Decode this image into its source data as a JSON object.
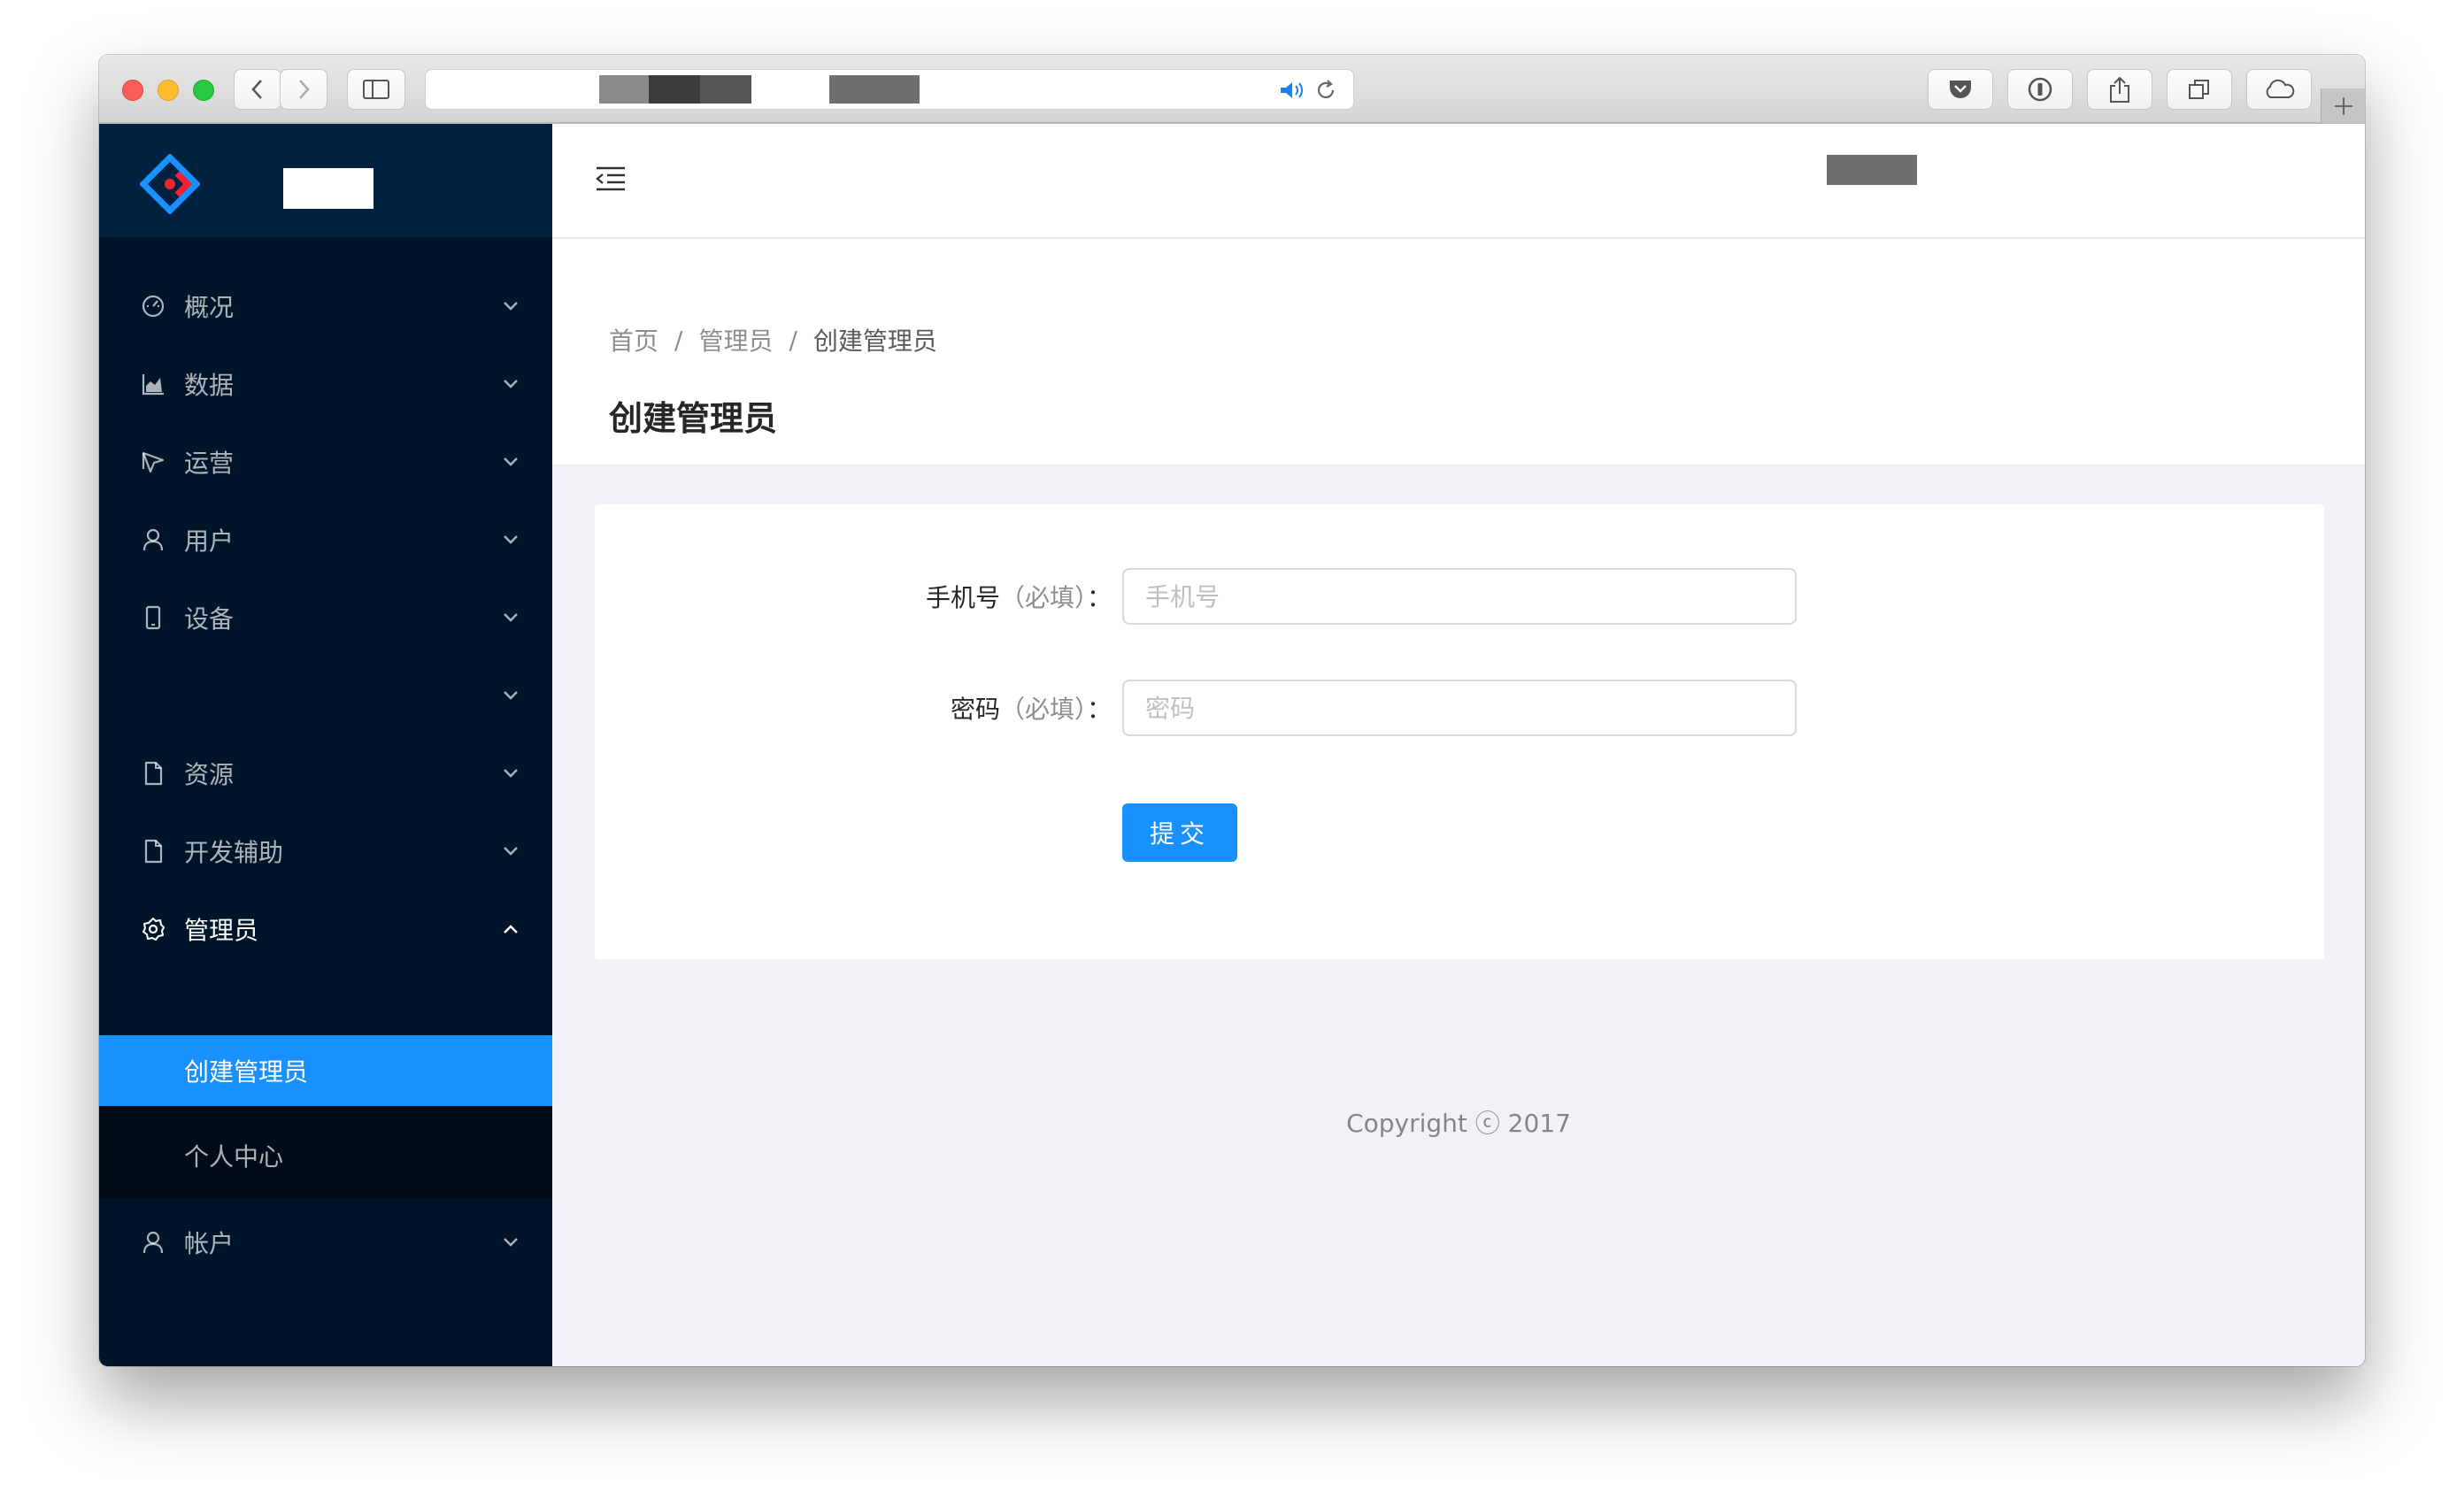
{
  "sidebar": {
    "items": [
      {
        "label": "概况",
        "icon": "dashboard-icon"
      },
      {
        "label": "数据",
        "icon": "area-chart-icon"
      },
      {
        "label": "运营",
        "icon": "cursor-icon"
      },
      {
        "label": "用户",
        "icon": "user-icon"
      },
      {
        "label": "设备",
        "icon": "mobile-icon"
      },
      {
        "label": "",
        "icon": ""
      },
      {
        "label": "资源",
        "icon": "file-icon"
      },
      {
        "label": "开发辅助",
        "icon": "file-icon"
      },
      {
        "label": "管理员",
        "icon": "setting-icon"
      },
      {
        "label": "帐户",
        "icon": "user-icon"
      }
    ],
    "submenu": [
      {
        "label": "创建管理员"
      },
      {
        "label": "个人中心"
      }
    ]
  },
  "breadcrumb": {
    "home": "首页",
    "section": "管理员",
    "current": "创建管理员",
    "separator": "/"
  },
  "page": {
    "title": "创建管理员"
  },
  "form": {
    "phone": {
      "label": "手机号",
      "required": "（必填）",
      "colon": "：",
      "placeholder": "手机号",
      "value": ""
    },
    "password": {
      "label": "密码",
      "required": "（必填）",
      "colon": "：",
      "placeholder": "密码",
      "value": ""
    },
    "submit_label": "提交"
  },
  "footer": {
    "copyright": "Copyright ⓒ 2017"
  },
  "colors": {
    "sidebar_bg": "#001529",
    "sidebar_head_bg": "#002140",
    "accent": "#1890ff",
    "content_bg": "#f0f2f5"
  }
}
